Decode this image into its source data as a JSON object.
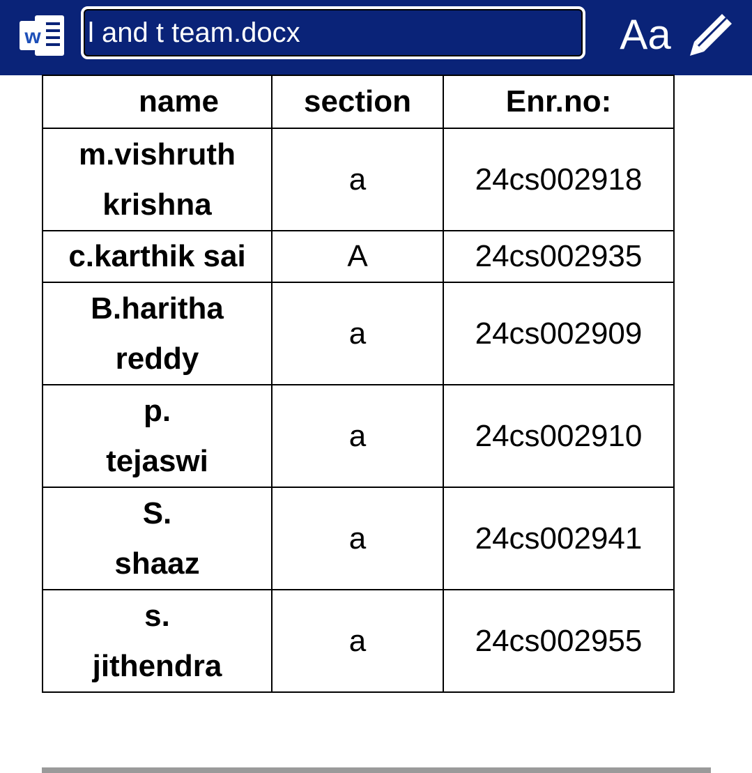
{
  "app": {
    "icon": "word-doc-icon",
    "title": "l and t team.docx",
    "font_button_label": "Aa",
    "edit_icon": "pencil-icon",
    "colors": {
      "toolbar_bg": "#0a2378",
      "toolbar_text": "#ffffff"
    }
  },
  "table": {
    "headers": [
      "name",
      "section",
      "Enr.no:"
    ],
    "rows": [
      {
        "name_lines": [
          "m.vishruth",
          "krishna"
        ],
        "section": "a",
        "enr": "24cs002918"
      },
      {
        "name_lines": [
          "c.karthik sai"
        ],
        "section": "A",
        "enr": "24cs002935"
      },
      {
        "name_lines": [
          "B.haritha",
          "reddy"
        ],
        "section": "a",
        "enr": "24cs002909"
      },
      {
        "name_lines": [
          "p.",
          "tejaswi"
        ],
        "section": "a",
        "enr": "24cs002910"
      },
      {
        "name_lines": [
          "S.",
          "shaaz"
        ],
        "section": "a",
        "enr": "24cs002941"
      },
      {
        "name_lines": [
          "s.",
          "jithendra"
        ],
        "section": "a",
        "enr": "24cs002955"
      }
    ]
  }
}
